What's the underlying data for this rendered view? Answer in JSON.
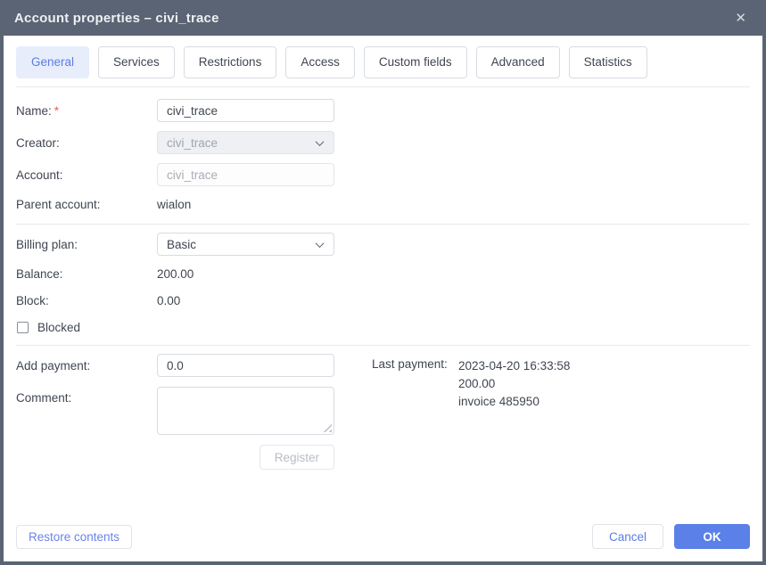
{
  "dialog": {
    "title": "Account properties – civi_trace",
    "close_icon": "✕"
  },
  "tabs": [
    {
      "label": "General",
      "active": true
    },
    {
      "label": "Services",
      "active": false
    },
    {
      "label": "Restrictions",
      "active": false
    },
    {
      "label": "Access",
      "active": false
    },
    {
      "label": "Custom fields",
      "active": false
    },
    {
      "label": "Advanced",
      "active": false
    },
    {
      "label": "Statistics",
      "active": false
    }
  ],
  "form": {
    "name": {
      "label": "Name:",
      "required_mark": "*",
      "value": "civi_trace"
    },
    "creator": {
      "label": "Creator:",
      "value": "civi_trace",
      "disabled": true
    },
    "account": {
      "label": "Account:",
      "value": "civi_trace",
      "disabled": true
    },
    "parent_account": {
      "label": "Parent account:",
      "value": "wialon"
    },
    "billing_plan": {
      "label": "Billing plan:",
      "value": "Basic"
    },
    "balance": {
      "label": "Balance:",
      "value": "200.00"
    },
    "block": {
      "label": "Block:",
      "value": "0.00"
    },
    "blocked": {
      "label": "Blocked",
      "checked": false
    },
    "add_payment": {
      "label": "Add payment:",
      "value": "0.0"
    },
    "comment": {
      "label": "Comment:",
      "value": ""
    },
    "register_button": "Register",
    "last_payment": {
      "label": "Last payment:",
      "lines": [
        "2023-04-20 16:33:58",
        "200.00",
        "invoice 485950"
      ]
    }
  },
  "footer": {
    "restore_button": "Restore contents",
    "cancel_button": "Cancel",
    "ok_button": "OK"
  },
  "colors": {
    "titlebar": "#5a6474",
    "accent_blue": "#5b7de4",
    "active_tab_bg": "#e8edfc",
    "ok_button_bg": "#5b80e8",
    "required_red": "#e8604c",
    "disabled_text": "#a0a6b0",
    "input_border": "#d8dbe1",
    "divider": "#e7e9ec"
  }
}
